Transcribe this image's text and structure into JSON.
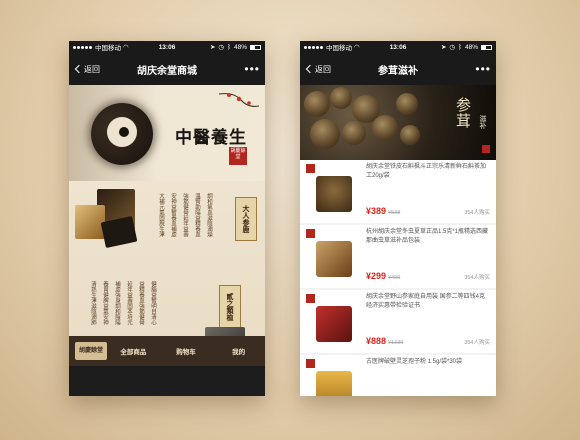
{
  "status": {
    "carrier": "中国移动",
    "time": "13:06",
    "battery": "48%"
  },
  "phone1": {
    "back": "返回",
    "title": "胡庆余堂商城",
    "banner_title": "中醫養生",
    "seal_text": "胡慶餘堂",
    "category1_tag": "大人参鹿",
    "category2_tag": "貳之類植",
    "tabbar": {
      "logo": "胡慶餘堂",
      "items": [
        "全部商品",
        "购物车",
        "我的"
      ]
    }
  },
  "phone2": {
    "back": "返回",
    "title": "参茸滋补",
    "banner_title": "参茸",
    "banner_sub": "滋补",
    "products": [
      {
        "name": "胡庆余堂铁皮石斛枫斗正宗乐清新鲜石斛茶加工20g/袋",
        "price": "¥389",
        "orig": "¥538",
        "sold": "354人购买"
      },
      {
        "name": "杭州胡庆余堂冬虫夏草正品1.5克*1瓶精选西藏那曲虫草滋补品包装",
        "price": "¥299",
        "orig": "¥499",
        "sold": "354人购买"
      },
      {
        "name": "胡庆余堂野山参家庭自用装 国参二等四钱4克 经济实惠带检验证书",
        "price": "¥888",
        "orig": "¥1330",
        "sold": "354人购买"
      },
      {
        "name": "古医牌破壁灵芝孢子粉 1.5g/袋*30袋",
        "price": "",
        "orig": "",
        "sold": ""
      }
    ]
  },
  "colors": {
    "accent": "#d8261c",
    "navbar": "#1a1a1a",
    "tabbar": "#3b2c22"
  }
}
